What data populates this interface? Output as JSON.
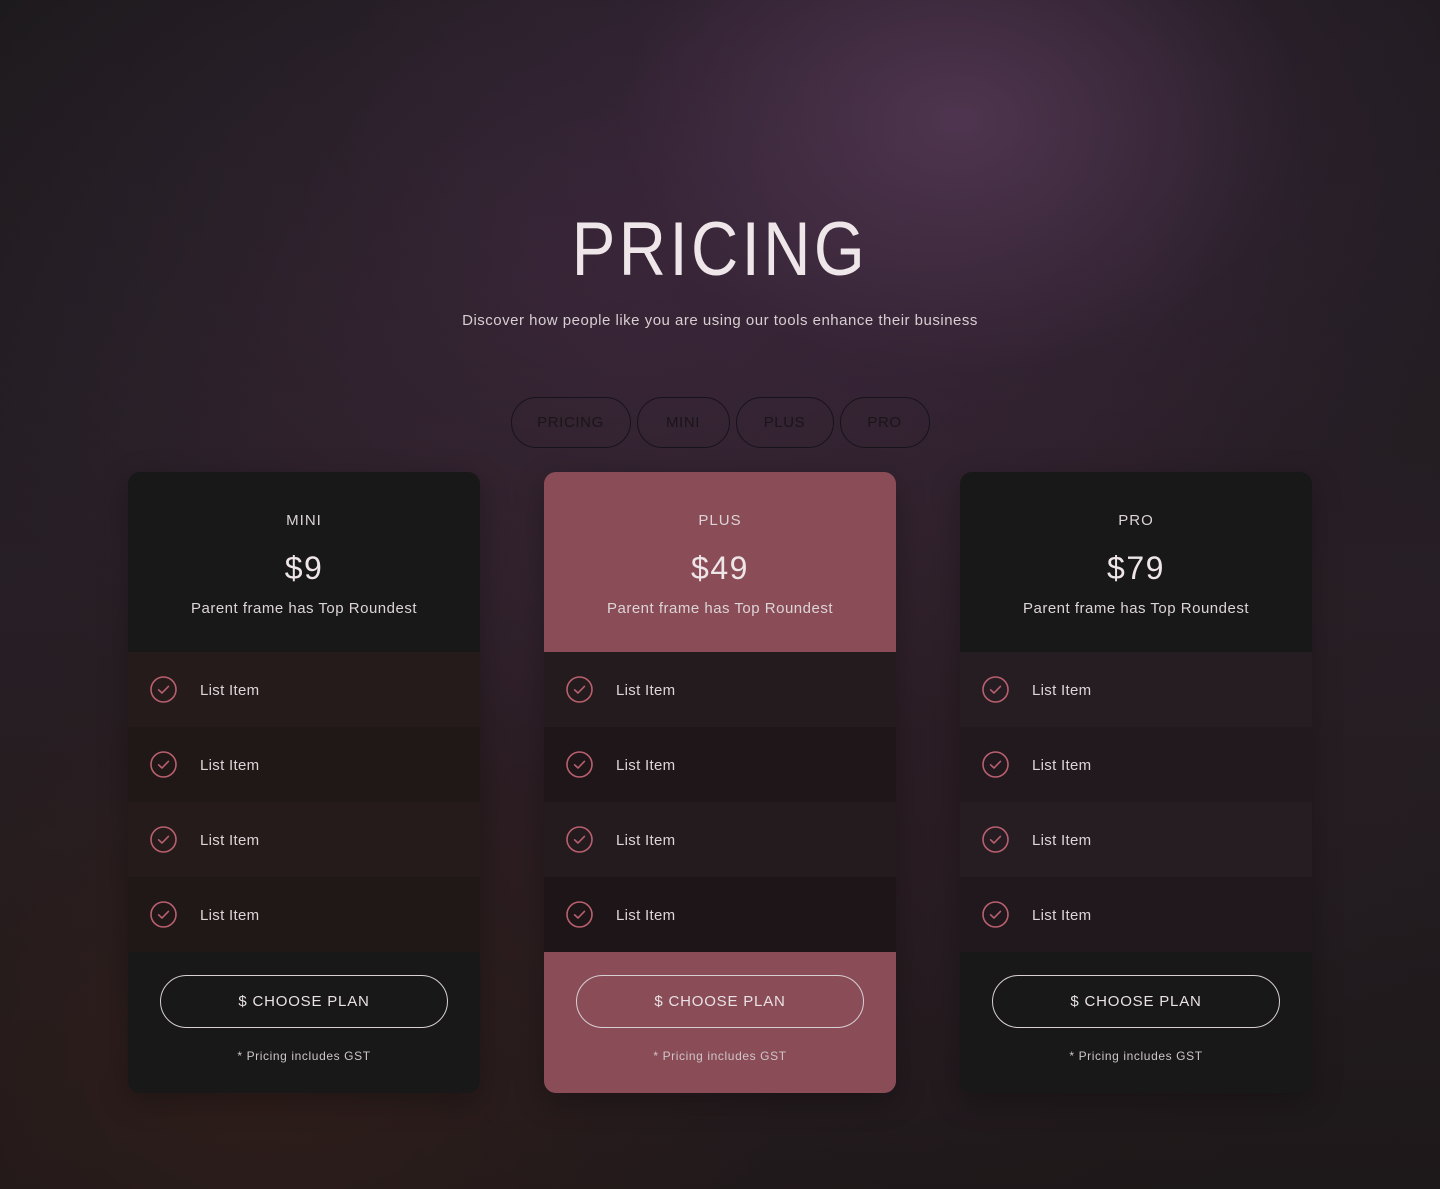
{
  "header": {
    "title": "PRICING",
    "subtitle": "Discover how people like you are using our tools enhance their business"
  },
  "tabs": [
    {
      "label": "PRICING"
    },
    {
      "label": "MINI"
    },
    {
      "label": "PLUS"
    },
    {
      "label": "PRO"
    }
  ],
  "colors": {
    "accent": "#8a4d57",
    "check": "#b9606e",
    "card_dark": "#181818"
  },
  "plans": [
    {
      "name": "MINI",
      "price": "$9",
      "description": "Parent frame has Top Roundest",
      "items": [
        {
          "label": "List Item",
          "icon": "check-circle-icon"
        },
        {
          "label": "List Item",
          "icon": "check-circle-icon"
        },
        {
          "label": "List Item",
          "icon": "check-circle-icon"
        },
        {
          "label": "List Item",
          "icon": "check-circle-icon"
        }
      ],
      "button_label": "$ CHOOSE PLAN",
      "note": "* Pricing includes GST"
    },
    {
      "name": "PLUS",
      "price": "$49",
      "description": "Parent frame has Top Roundest",
      "items": [
        {
          "label": "List Item",
          "icon": "check-circle-icon"
        },
        {
          "label": "List Item",
          "icon": "check-circle-icon"
        },
        {
          "label": "List Item",
          "icon": "check-circle-icon"
        },
        {
          "label": "List Item",
          "icon": "check-circle-icon"
        }
      ],
      "button_label": "$ CHOOSE PLAN",
      "note": "* Pricing includes GST"
    },
    {
      "name": "PRO",
      "price": "$79",
      "description": "Parent frame has Top Roundest",
      "items": [
        {
          "label": "List Item",
          "icon": "check-circle-icon"
        },
        {
          "label": "List Item",
          "icon": "check-circle-icon"
        },
        {
          "label": "List Item",
          "icon": "check-circle-icon"
        },
        {
          "label": "List Item",
          "icon": "check-circle-icon"
        }
      ],
      "button_label": "$ CHOOSE PLAN",
      "note": "* Pricing includes GST"
    }
  ]
}
